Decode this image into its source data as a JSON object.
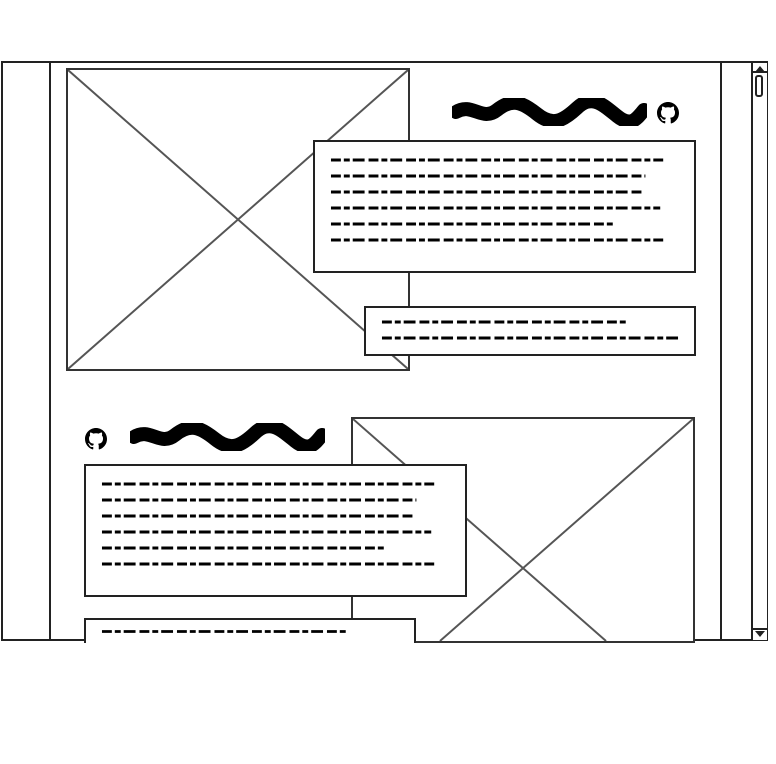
{
  "wireframe": {
    "colors": {
      "stroke": "#222222",
      "placeholder_stroke": "#555555",
      "scribble": "#000000"
    },
    "icons": [
      "github-icon",
      "github-icon"
    ],
    "sections": [
      {
        "layout": "image-left-text-right",
        "heading_icon": "github-icon",
        "paragraph_lines": 6,
        "caption_lines": 2
      },
      {
        "layout": "text-left-image-right",
        "heading_icon": "github-icon",
        "paragraph_lines": 6,
        "caption_lines": 1
      }
    ]
  }
}
